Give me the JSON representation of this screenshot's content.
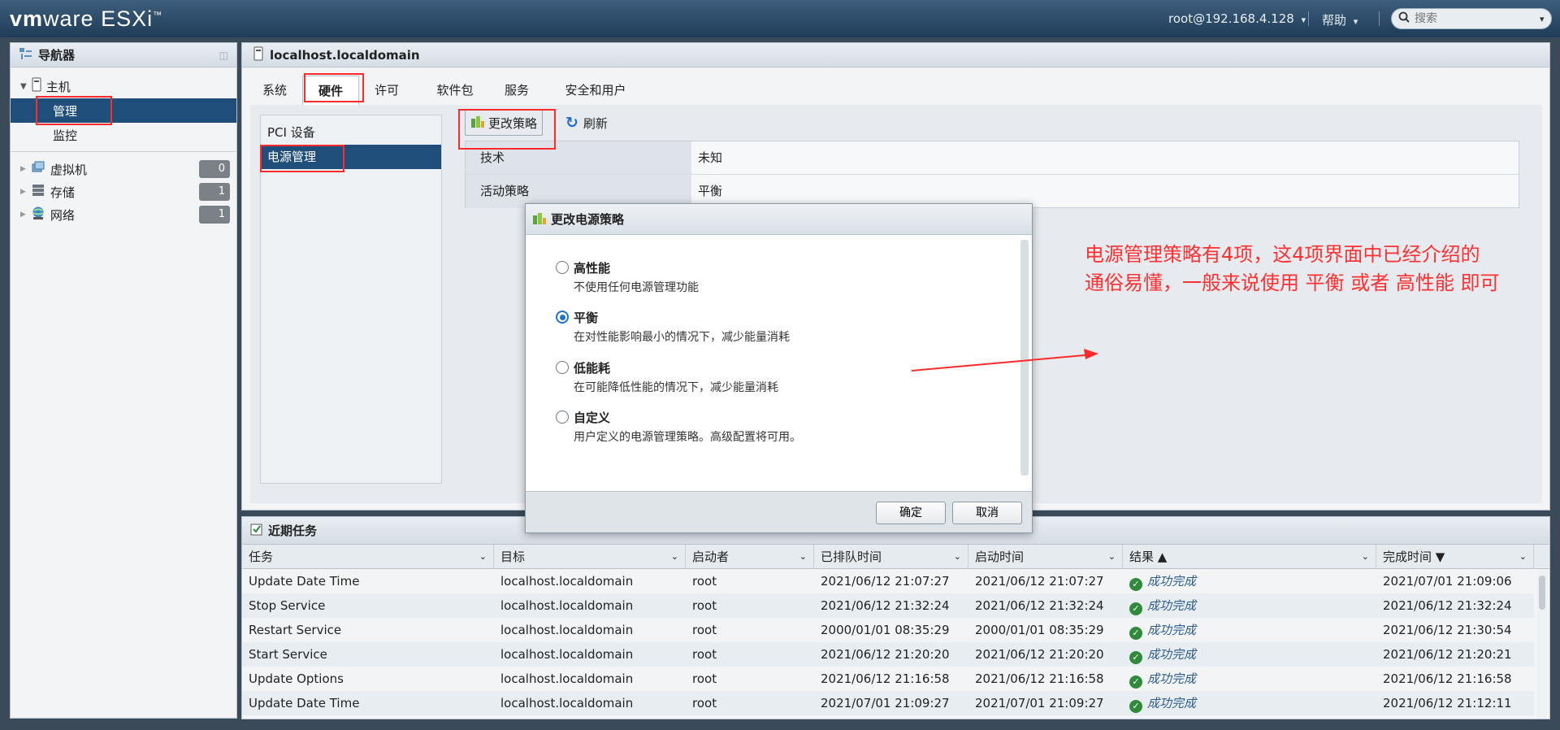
{
  "header": {
    "logo_brand": "vm",
    "logo_ware": "ware",
    "logo_product": "ESXi",
    "logo_tm": "™",
    "user": "root@192.168.4.128",
    "help": "帮助",
    "search_placeholder": "搜索"
  },
  "navigator": {
    "title": "导航器",
    "host_label": "主机",
    "manage_label": "管理",
    "monitor_label": "监控",
    "items": [
      {
        "label": "虚拟机",
        "count": "0"
      },
      {
        "label": "存储",
        "count": "1"
      },
      {
        "label": "网络",
        "count": "1"
      }
    ]
  },
  "main": {
    "title": "localhost.localdomain",
    "tabs": [
      "系统",
      "硬件",
      "许可",
      "软件包",
      "服务",
      "安全和用户"
    ],
    "active_tab": "硬件",
    "subnav": [
      "PCI 设备",
      "电源管理"
    ],
    "toolbar": {
      "change_policy": "更改策略",
      "refresh": "刷新"
    },
    "grid": [
      {
        "key": "技术",
        "value": "未知"
      },
      {
        "key": "活动策略",
        "value": "平衡"
      }
    ]
  },
  "dialog": {
    "title": "更改电源策略",
    "options": [
      {
        "title": "高性能",
        "desc": "不使用任何电源管理功能",
        "selected": false
      },
      {
        "title": "平衡",
        "desc": "在对性能影响最小的情况下，减少能量消耗",
        "selected": true
      },
      {
        "title": "低能耗",
        "desc": "在可能降低性能的情况下，减少能量消耗",
        "selected": false
      },
      {
        "title": "自定义",
        "desc": "用户定义的电源管理策略。高级配置将可用。",
        "selected": false
      }
    ],
    "ok": "确定",
    "cancel": "取消"
  },
  "tasks": {
    "title": "近期任务",
    "columns": [
      "任务",
      "目标",
      "启动者",
      "已排队时间",
      "启动时间",
      "结果 ▲",
      "完成时间 ▼"
    ],
    "rows": [
      [
        "Update Date Time",
        "localhost.localdomain",
        "root",
        "2021/06/12 21:07:27",
        "2021/06/12 21:07:27",
        "成功完成",
        "2021/07/01 21:09:06"
      ],
      [
        "Stop Service",
        "localhost.localdomain",
        "root",
        "2021/06/12 21:32:24",
        "2021/06/12 21:32:24",
        "成功完成",
        "2021/06/12 21:32:24"
      ],
      [
        "Restart Service",
        "localhost.localdomain",
        "root",
        "2000/01/01 08:35:29",
        "2000/01/01 08:35:29",
        "成功完成",
        "2021/06/12 21:30:54"
      ],
      [
        "Start Service",
        "localhost.localdomain",
        "root",
        "2021/06/12 21:20:20",
        "2021/06/12 21:20:20",
        "成功完成",
        "2021/06/12 21:20:21"
      ],
      [
        "Update Options",
        "localhost.localdomain",
        "root",
        "2021/06/12 21:16:58",
        "2021/06/12 21:16:58",
        "成功完成",
        "2021/06/12 21:16:58"
      ],
      [
        "Update Date Time",
        "localhost.localdomain",
        "root",
        "2021/07/01 21:09:27",
        "2021/07/01 21:09:27",
        "成功完成",
        "2021/06/12 21:12:11"
      ]
    ]
  },
  "annotation": {
    "line1": "电源管理策略有4项，这4项界面中已经介绍的",
    "line2": "通俗易懂，一般来说使用 平衡 或者 高性能 即可"
  },
  "colors": {
    "selected": "#1f4e7a",
    "highlight": "#ff2b2b",
    "success": "#2f8a3a"
  }
}
